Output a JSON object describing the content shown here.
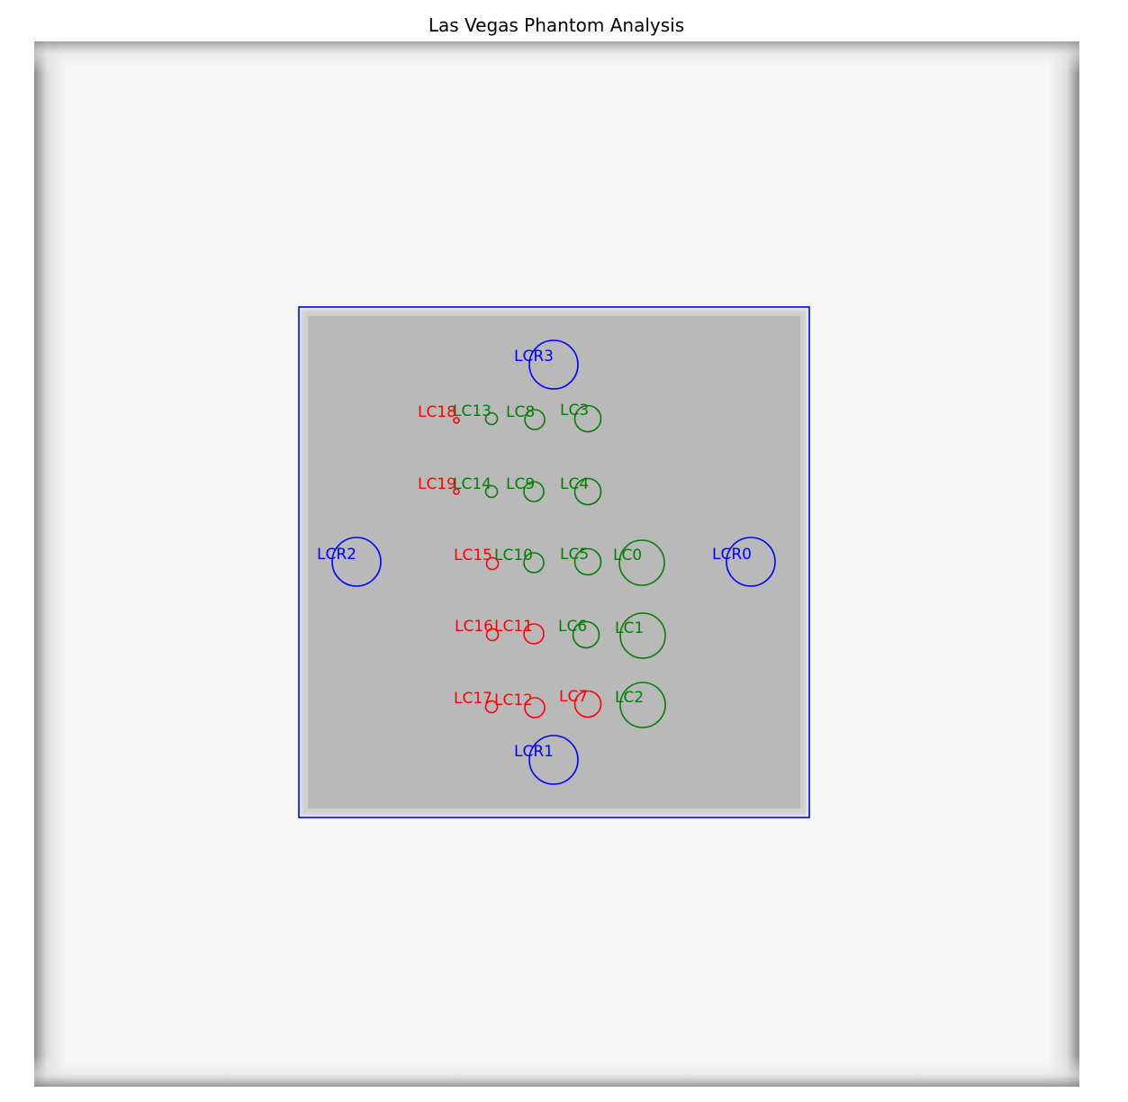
{
  "title": "Las Vegas Phantom Analysis",
  "colors": {
    "background": "#ffffff",
    "image_light": "#f7f7f7",
    "image_edge": "#8c8c8c",
    "phantom_fill": "#b9b9b9",
    "boundary": "#0000ff",
    "pass": "#008000",
    "fail": "#ff0000",
    "reference": "#0000ff"
  },
  "legend_semantics": {
    "green": "pass",
    "red": "fail",
    "blue": "reference"
  },
  "rois": [
    {
      "label": "LCR0",
      "status": "reference"
    },
    {
      "label": "LCR1",
      "status": "reference"
    },
    {
      "label": "LCR2",
      "status": "reference"
    },
    {
      "label": "LCR3",
      "status": "reference"
    },
    {
      "label": "LC0",
      "status": "pass"
    },
    {
      "label": "LC1",
      "status": "pass"
    },
    {
      "label": "LC2",
      "status": "pass"
    },
    {
      "label": "LC3",
      "status": "pass"
    },
    {
      "label": "LC4",
      "status": "pass"
    },
    {
      "label": "LC5",
      "status": "pass"
    },
    {
      "label": "LC6",
      "status": "pass"
    },
    {
      "label": "LC7",
      "status": "fail"
    },
    {
      "label": "LC8",
      "status": "pass"
    },
    {
      "label": "LC9",
      "status": "pass"
    },
    {
      "label": "LC10",
      "status": "pass"
    },
    {
      "label": "LC11",
      "status": "fail"
    },
    {
      "label": "LC12",
      "status": "fail"
    },
    {
      "label": "LC13",
      "status": "pass"
    },
    {
      "label": "LC14",
      "status": "pass"
    },
    {
      "label": "LC15",
      "status": "fail"
    },
    {
      "label": "LC16",
      "status": "fail"
    },
    {
      "label": "LC17",
      "status": "fail"
    },
    {
      "label": "LC18",
      "status": "fail"
    },
    {
      "label": "LC19",
      "status": "fail"
    }
  ]
}
